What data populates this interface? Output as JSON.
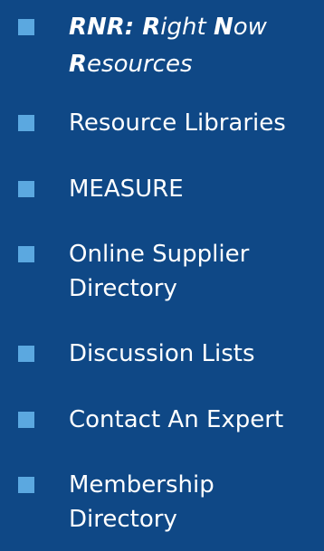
{
  "menu": {
    "featured": {
      "part1_bold": "RNR: R",
      "part2": "ight ",
      "part3_bold": "N",
      "part4": "ow",
      "part5_bold": "R",
      "part6": "esources"
    },
    "items": [
      {
        "line1": "Resource Libraries",
        "line2": ""
      },
      {
        "line1": "MEASURE",
        "line2": ""
      },
      {
        "line1": "Online Supplier",
        "line2": "Directory"
      },
      {
        "line1": "Discussion Lists",
        "line2": ""
      },
      {
        "line1": "Contact An Expert",
        "line2": ""
      },
      {
        "line1": "Membership",
        "line2": "Directory"
      }
    ]
  },
  "colors": {
    "background": "#0f4886",
    "bullet": "#5ba8e0",
    "text": "#ffffff"
  },
  "icons": {
    "bullet": "square-bullet-icon"
  }
}
